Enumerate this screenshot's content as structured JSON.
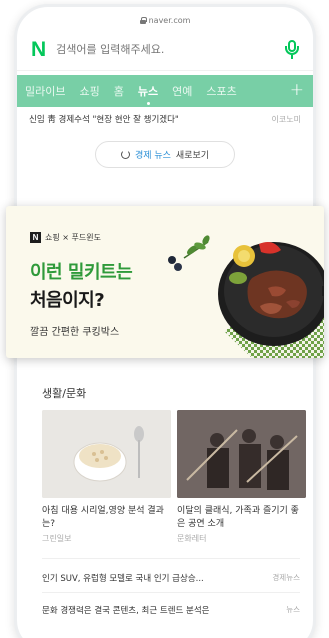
{
  "browser": {
    "url": "naver.com"
  },
  "search": {
    "logo": "N",
    "placeholder": "검색어를 입력해주세요."
  },
  "tabs": [
    {
      "label": "밀라이브"
    },
    {
      "label": "쇼핑"
    },
    {
      "label": "홈"
    },
    {
      "label": "뉴스",
      "active": true
    },
    {
      "label": "연예"
    },
    {
      "label": "스포츠"
    }
  ],
  "tabs_plus": "+",
  "headline": {
    "text": "신임 靑 경제수석 \"현장 현안 잘 챙기겠다\"",
    "source": "이코노미"
  },
  "more_button": {
    "highlight": "경제 뉴스",
    "rest": "새로보기"
  },
  "ad": {
    "brand": "쇼핑 × 푸드윈도",
    "brand_logo": "N",
    "line1": "이런 밀키트는",
    "line2": "처음이지?",
    "sub": "깔끔 간편한 쿠킹박스"
  },
  "life": {
    "title": "생활/문화",
    "cards": [
      {
        "caption": "아침 대용 시리얼,영양 분석 결과는?",
        "source": "그린일보"
      },
      {
        "caption": "이달의 클래식, 가족과 즐기기 좋은 공연 소개",
        "source": "문화레터"
      }
    ],
    "rows": [
      {
        "text": "인기 SUV, 유럽형 모델로 국내 인기 급상승...",
        "source": "경제뉴스"
      },
      {
        "text": "문화 경쟁력은 결국 콘텐츠, 최근 트렌드 분석은",
        "source": "뉴스"
      }
    ]
  },
  "colors": {
    "naver_green": "#03c75a",
    "tab_bar": "#78cfa6",
    "ad_green": "#2f9a3a",
    "link_blue": "#2a8fd6"
  }
}
